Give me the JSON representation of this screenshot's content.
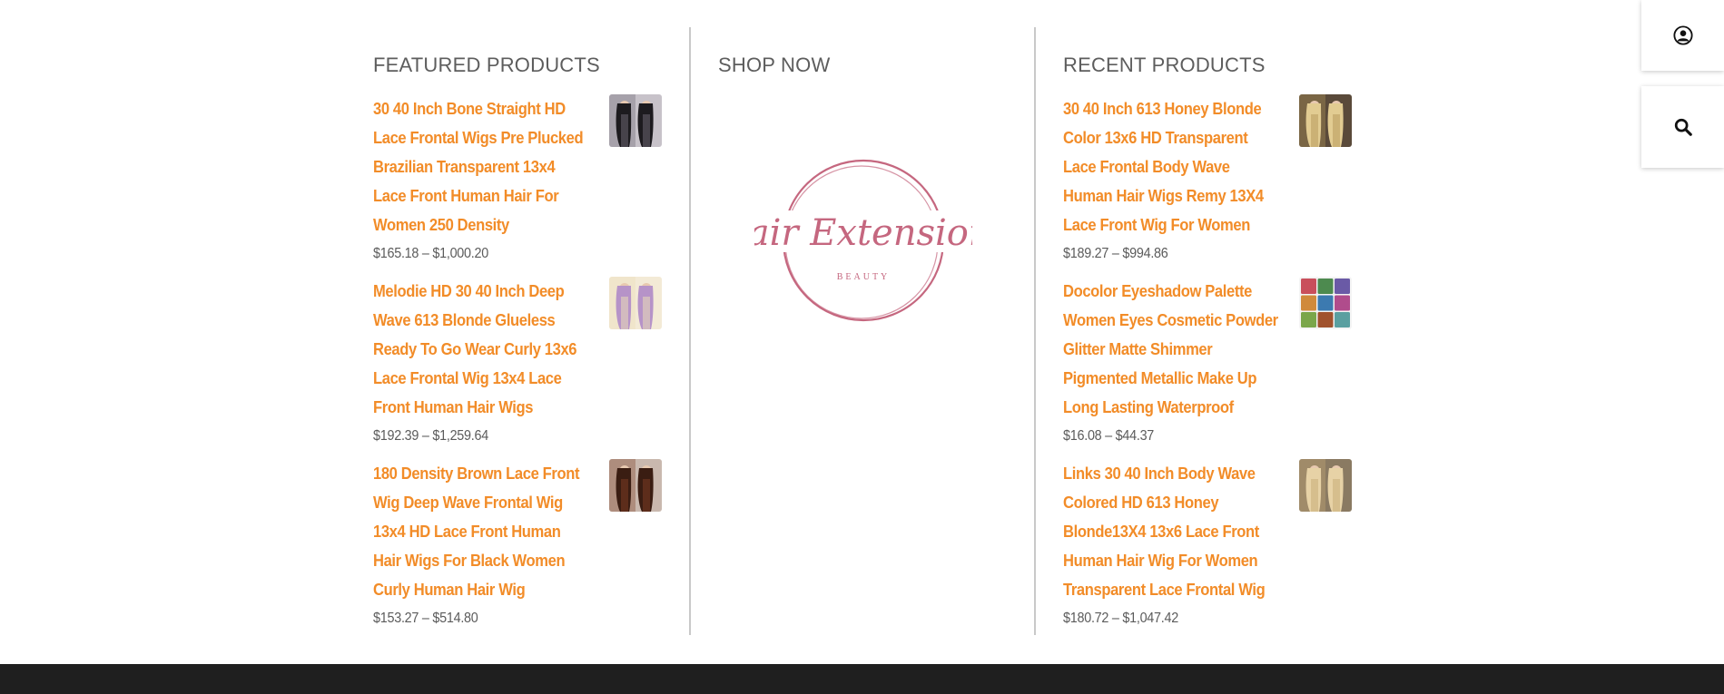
{
  "featured": {
    "title": "FEATURED PRODUCTS",
    "products": [
      {
        "name": "30 40 Inch Bone Straight HD Lace Frontal Wigs Pre Plucked Brazilian Transparent 13x4 Lace Front Human Hair For Women 250 Density",
        "price": "$165.18 – $1,000.20",
        "thumb_colors": [
          "#1d1b1f",
          "#6a6570",
          "#c7c2c9"
        ]
      },
      {
        "name": "Melodie HD 30 40 Inch Deep Wave 613 Blonde Glueless Ready To Go Wear Curly 13x6 Lace Frontal Wig 13x4 Lace Front Human Hair Wigs",
        "price": "$192.39 – $1,259.64",
        "thumb_colors": [
          "#b693c8",
          "#eadcb8",
          "#f3ead6"
        ]
      },
      {
        "name": "180 Density Brown Lace Front Wig Deep Wave Frontal Wig 13x4 HD Lace Front Human Hair Wigs For Black Women Curly Human Hair Wig",
        "price": "$153.27 – $514.80",
        "thumb_colors": [
          "#3a1d12",
          "#7a3b22",
          "#c9b8ae"
        ]
      }
    ]
  },
  "shop": {
    "title": "SHOP NOW",
    "logo_script": "Hair Extensions",
    "logo_sub": "BEAUTY",
    "logo_color": "#c5677f"
  },
  "recent": {
    "title": "RECENT PRODUCTS",
    "products": [
      {
        "name": "30 40 Inch 613 Honey Blonde Color 13x6 HD Transparent Lace Frontal Body Wave Human Hair Wigs Remy 13X4 Lace Front Wig For Women",
        "price": "$189.27 – $994.86",
        "thumb_colors": [
          "#e2cc92",
          "#b89a5c",
          "#5a4a3a"
        ]
      },
      {
        "name": "Docolor Eyeshadow Palette Women Eyes Cosmetic Powder Glitter Matte Shimmer Pigmented Metallic Make Up Long Lasting Waterproof",
        "price": "$16.08 – $44.37",
        "thumb_colors": [
          "#c94f5b",
          "#4d8a4f",
          "#6a5aa6"
        ]
      },
      {
        "name": "Links 30 40 Inch Body Wave Colored HD 613 Honey Blonde13X4 13x6 Lace Front Human Hair Wig For Women Transparent Lace Frontal Wig",
        "price": "$180.72 – $1,047.42",
        "thumb_colors": [
          "#e7d2a6",
          "#c9ad78",
          "#8a7a62"
        ]
      }
    ]
  },
  "side_buttons": {
    "account_icon": "user-circle-icon",
    "search_icon": "search-icon"
  },
  "colors": {
    "link": "#f28c28",
    "title": "#5d5d5d",
    "price": "#5b5b5b",
    "divider": "#c9c9c9",
    "footer": "#1f1f1f"
  }
}
